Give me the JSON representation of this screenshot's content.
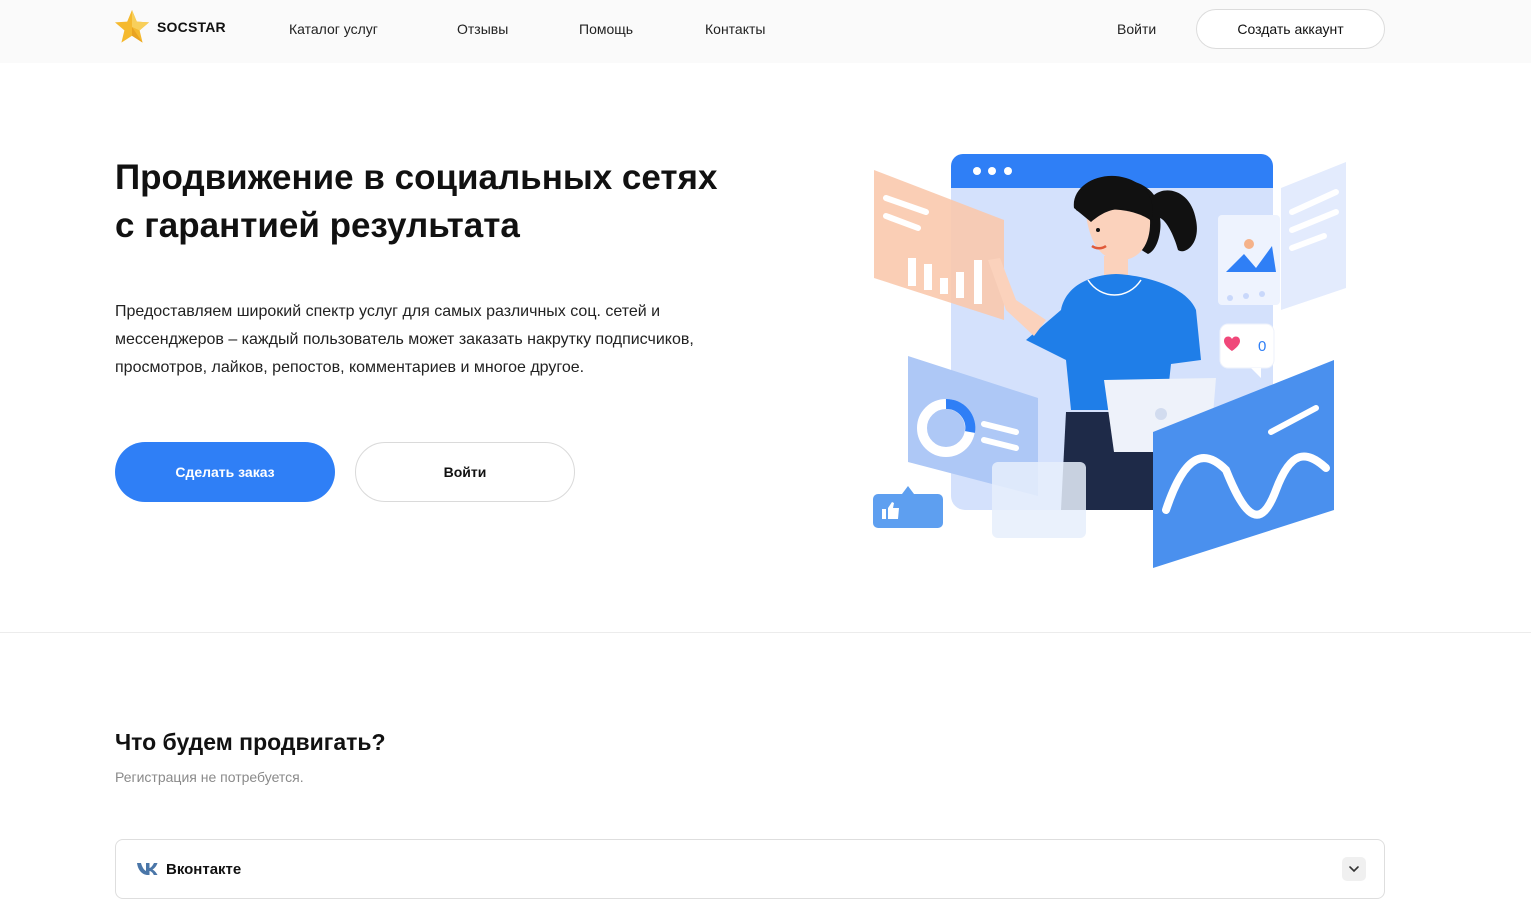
{
  "header": {
    "logo_text": "SOCSTAR",
    "nav": [
      "Каталог услуг",
      "Отзывы",
      "Помощь",
      "Контакты"
    ],
    "login_label": "Войти",
    "create_account_label": "Создать аккаунт"
  },
  "hero": {
    "title_line1": "Продвижение в социальных сетях",
    "title_line2": "с гарантией результата",
    "desc_line1": "Предоставляем широкий спектр услуг для самых различных соц. сетей и",
    "desc_line2": "мессенджеров – каждый пользователь может заказать накрутку подписчиков,",
    "desc_line3": "просмотров, лайков, репостов, комментариев и многое другое.",
    "order_button": "Сделать заказ",
    "login_button": "Войти",
    "like_count": "0"
  },
  "section": {
    "title": "Что будем продвигать?",
    "subtitle": "Регистрация не потребуется.",
    "items": [
      {
        "label": "Вконтакте",
        "icon": "vk-icon"
      }
    ]
  },
  "colors": {
    "accent": "#2f7ff6",
    "header_bg": "#fafafa",
    "logo_star": "#f5b92e",
    "vk": "#4a76a8"
  }
}
